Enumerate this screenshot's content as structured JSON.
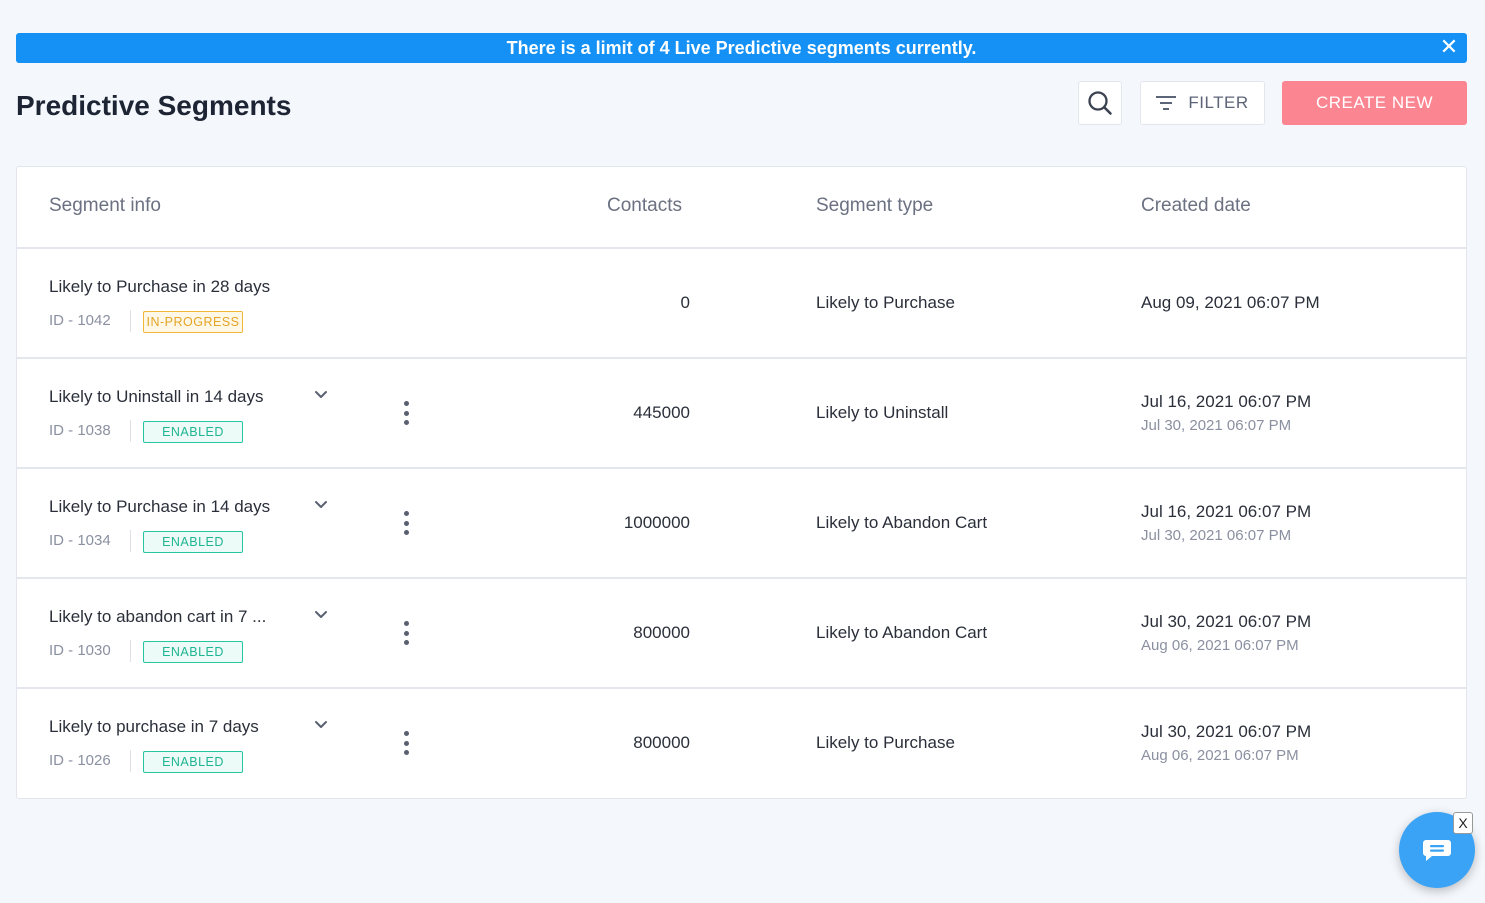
{
  "banner": {
    "text": "There is a limit of 4 Live Predictive segments currently.",
    "close_label": "✕"
  },
  "page": {
    "title": "Predictive Segments"
  },
  "toolbar": {
    "search_icon": "search-icon",
    "filter_label": "FILTER",
    "create_label": "CREATE NEW",
    "create_color": "#fb8591"
  },
  "table": {
    "headers": {
      "segment_info": "Segment info",
      "contacts": "Contacts",
      "segment_type": "Segment type",
      "created_date": "Created date"
    },
    "rows": [
      {
        "name": "Likely to Purchase in 28 days",
        "id": "ID - 1042",
        "status": "IN-PROGRESS",
        "contacts": "0",
        "type": "Likely to Purchase",
        "created": "Aug 09, 2021 06:07 PM",
        "sub_date": ""
      },
      {
        "name": "Likely to Uninstall in 14 days",
        "id": "ID - 1038",
        "status": "ENABLED",
        "contacts": "445000",
        "type": "Likely to Uninstall",
        "created": "Jul 16, 2021 06:07 PM",
        "sub_date": "Jul 30, 2021 06:07 PM"
      },
      {
        "name": "Likely to Purchase in 14 days",
        "id": "ID - 1034",
        "status": "ENABLED",
        "contacts": "1000000",
        "type": "Likely to Abandon Cart",
        "created": "Jul 16, 2021 06:07 PM",
        "sub_date": "Jul 30, 2021 06:07 PM"
      },
      {
        "name": "Likely to abandon cart in 7 ...",
        "id": "ID - 1030",
        "status": "ENABLED",
        "contacts": "800000",
        "type": "Likely to Abandon Cart",
        "created": "Jul 30, 2021 06:07 PM",
        "sub_date": "Aug 06, 2021 06:07 PM"
      },
      {
        "name": "Likely to purchase in 7 days",
        "id": "ID - 1026",
        "status": "ENABLED",
        "contacts": "800000",
        "type": "Likely to Purchase",
        "created": "Jul 30, 2021 06:07 PM",
        "sub_date": "Aug 06, 2021 06:07 PM"
      }
    ]
  },
  "chat": {
    "icon": "chat-icon",
    "close_label": "X"
  },
  "colors": {
    "banner": "#1591f5",
    "enabled": "#1fb592",
    "in_progress": "#e4a426",
    "chat": "#3aa3f5"
  }
}
